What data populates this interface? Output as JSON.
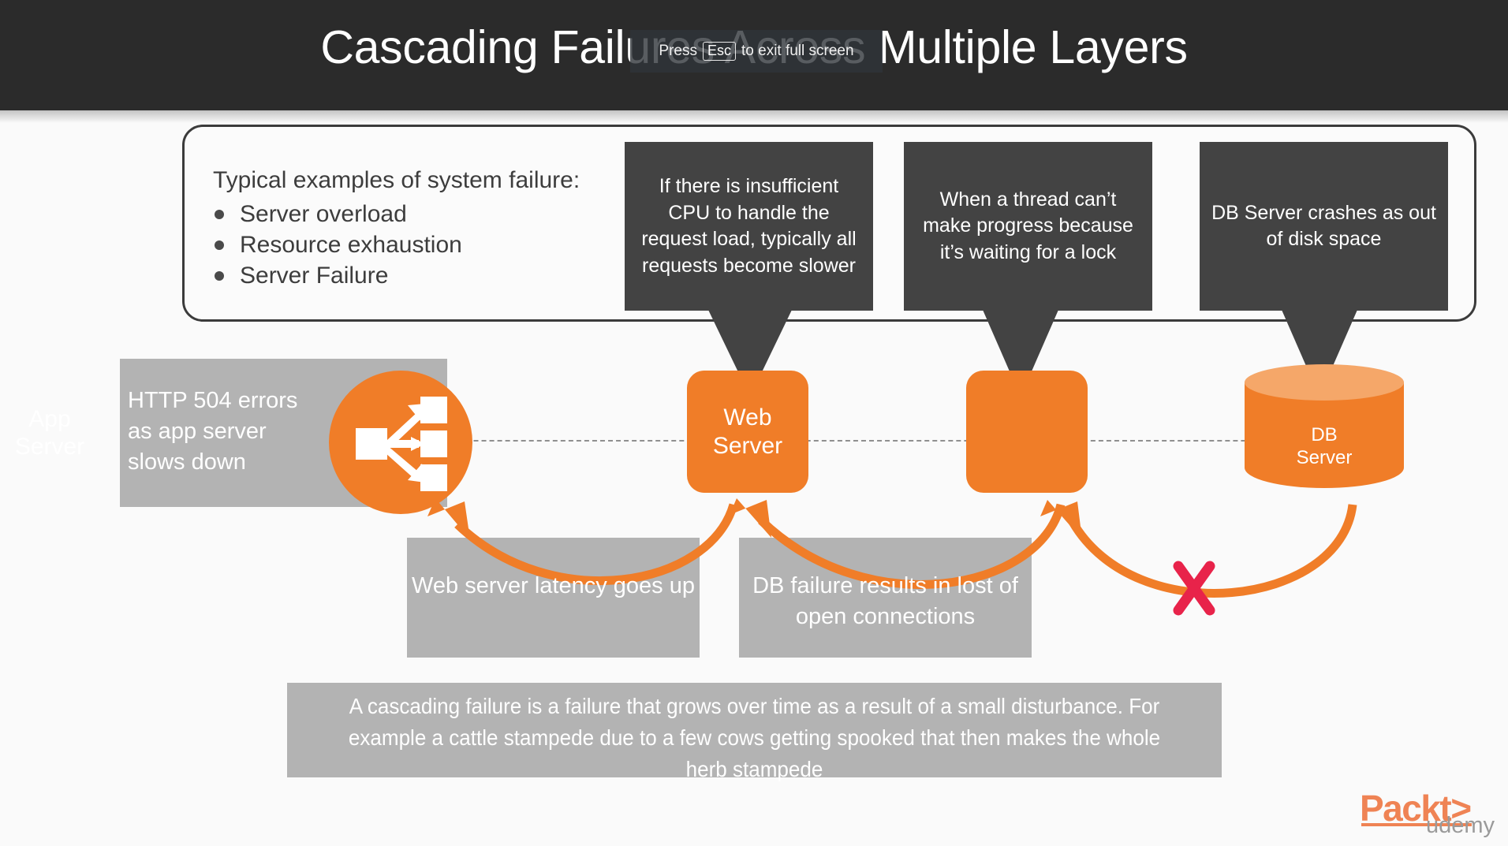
{
  "header": {
    "title": "Cascading Failures Across Multiple Layers",
    "fullscreen_toast": {
      "prefix": "Press",
      "key": "Esc",
      "suffix": "to exit full screen"
    },
    "background_color": "#2b2b2b"
  },
  "panel": {
    "heading": "Typical examples of system failure:",
    "bullets": [
      {
        "label": "Server  overload"
      },
      {
        "label": "Resource exhaustion"
      },
      {
        "label": "Server Failure"
      }
    ]
  },
  "callouts": [
    {
      "text": "If there is insufficient CPU to handle the request load, typically all requests become slower",
      "target": "web-server",
      "color": "#434343"
    },
    {
      "text": "When a thread can’t make progress because it’s waiting for a lock",
      "target": "app-tier",
      "color": "#434343"
    },
    {
      "text": "DB Server crashes as out of disk space",
      "target": "db-server",
      "color": "#434343"
    }
  ],
  "nodes": {
    "app_server": {
      "label": "App\nServer",
      "label_line1": "App",
      "label_line2": "Server",
      "icon": "load-balancer-icon",
      "color": "#f07d28"
    },
    "web_server": {
      "label_line1": "Web",
      "label_line2": "Server",
      "color": "#f07d28"
    },
    "middle_server": {
      "label": "",
      "color": "#f07d28"
    },
    "db_server": {
      "label_line1": "DB",
      "label_line2": "Server",
      "color": "#f07d28",
      "top_color": "#f5a769"
    }
  },
  "annotations": {
    "http_errors": "HTTP 504 errors\n as app server\nslows down",
    "http_errors_l1": "HTTP 504 errors",
    "http_errors_l2": " as app server",
    "http_errors_l3": "slows down",
    "web_latency": "Web server latency goes up",
    "db_failure": "DB failure results in lost of open connections",
    "failure_marker": "X",
    "failure_marker_color": "#e8234a",
    "arrow_color": "#f07d28",
    "box_color": "#b3b3b3"
  },
  "summary": {
    "text": "A cascading failure is a failure that grows over time as a result of a small disturbance. For example a cattle stampede due to a few cows getting spooked that then makes the whole herb stampede"
  },
  "logo": {
    "word": "Packt>",
    "sub": "udemy",
    "color": "#ef8354"
  }
}
